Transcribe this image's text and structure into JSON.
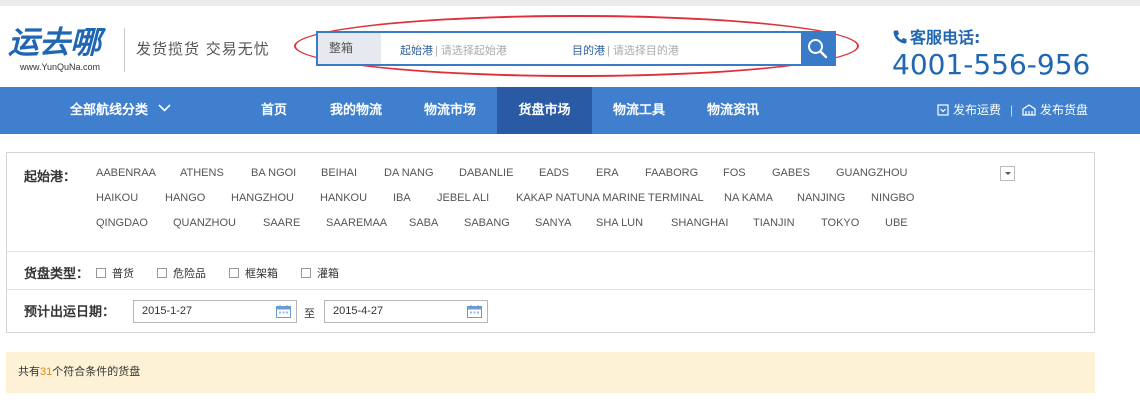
{
  "brand": {
    "logo_text": "运去哪",
    "logo_url_text": "www.YunQuNa.com",
    "slogan": "发货揽货 交易无忧",
    "accent_color": "#1f67b3"
  },
  "search": {
    "type_label": "整箱",
    "from_label": "起始港",
    "from_placeholder": "| 请选择起始港",
    "to_label": "目的港",
    "to_placeholder": "| 请选择目的港",
    "button_icon": "search-icon",
    "highlight_color": "#e0303a"
  },
  "service": {
    "label": "客服电话:",
    "number": "4001-556-956",
    "icon": "phone-icon"
  },
  "nav": {
    "category": "全部航线分类",
    "items": [
      "首页",
      "我的物流",
      "物流市场",
      "货盘市场",
      "物流工具",
      "物流资讯"
    ],
    "active": "货盘市场",
    "post_freight": "发布运费",
    "post_cargo": "发布货盘",
    "bar_color": "#3f7fcd",
    "active_color": "#2a5aa4"
  },
  "filter": {
    "port_label": "起始港：",
    "ports_row1": [
      "AABENRAA",
      "ATHENS",
      "BA NGOI",
      "BEIHAI",
      "DA NANG",
      "DABANLIE",
      "EADS",
      "ERA",
      "FAABORG",
      "FOS",
      "GABES",
      "GUANGZHOU"
    ],
    "ports_row2": [
      "HAIKOU",
      "HANGO",
      "HANGZHOU",
      "HANKOU",
      "IBA",
      "JEBEL ALI",
      "KAKAP NATUNA MARINE TERMINAL",
      "NA KAMA",
      "NANJING",
      "NINGBO"
    ],
    "ports_row3": [
      "QINGDAO",
      "QUANZHOU",
      "SAARE",
      "SAAREMAA",
      "SABA",
      "SABANG",
      "SANYA",
      "SHA LUN",
      "SHANGHAI",
      "TIANJIN",
      "TOKYO",
      "UBE"
    ],
    "type_label": "货盘类型：",
    "types": [
      "普货",
      "危险品",
      "框架箱",
      "灌箱"
    ],
    "date_label": "预计出运日期：",
    "date_from": "2015-1-27",
    "date_sep": "至",
    "date_to": "2015-4-27"
  },
  "result": {
    "prefix": "共有",
    "count": "31",
    "suffix": "个符合条件的货盘",
    "bg_color": "#fdf2d6"
  }
}
